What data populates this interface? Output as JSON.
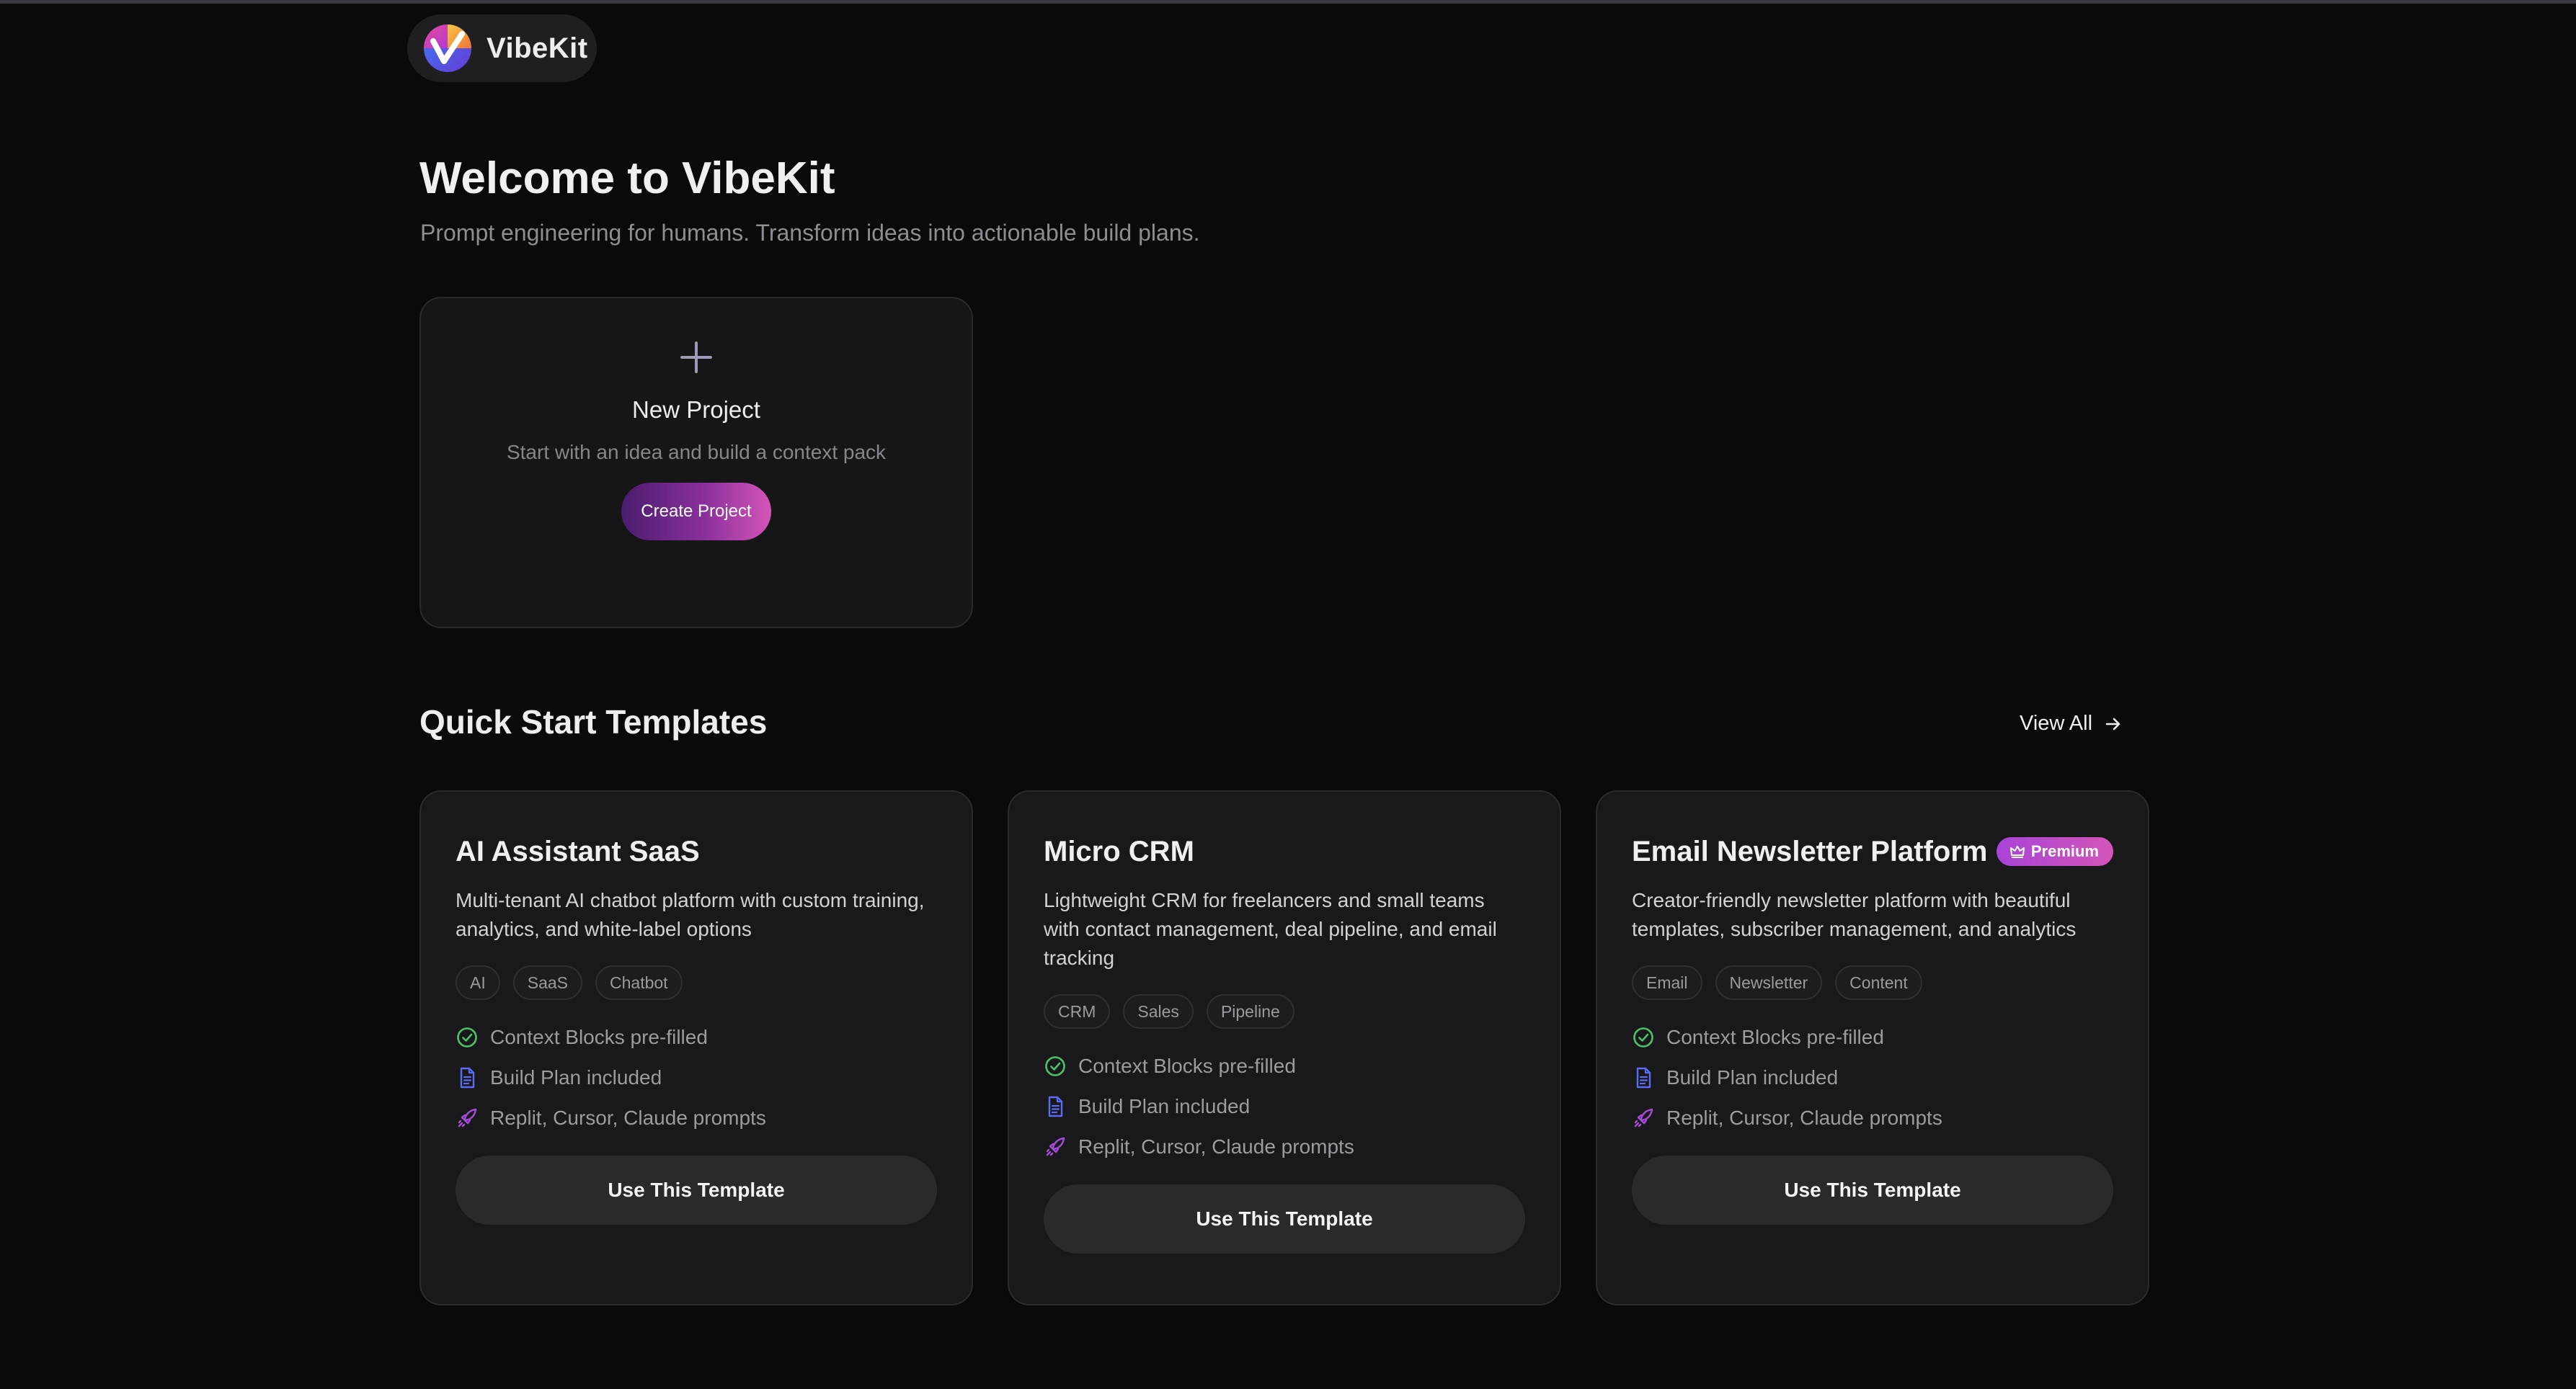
{
  "brand": {
    "name": "VibeKit",
    "logo_icon": "vibekit-logo-icon"
  },
  "welcome": {
    "title": "Welcome to VibeKit",
    "subtitle": "Prompt engineering for humans. Transform ideas into actionable build plans."
  },
  "new_project": {
    "icon": "plus-icon",
    "title": "New Project",
    "description": "Start with an idea and build a context pack",
    "button_label": "Create Project"
  },
  "templates_section": {
    "title": "Quick Start Templates",
    "view_all_label": "View All",
    "templates": [
      {
        "title": "AI Assistant SaaS",
        "premium": false,
        "description": "Multi-tenant AI chatbot platform with custom training, analytics, and white-label options",
        "tags": [
          "AI",
          "SaaS",
          "Chatbot"
        ],
        "features": [
          "Context Blocks pre-filled",
          "Build Plan included",
          "Replit, Cursor, Claude prompts"
        ],
        "button_label": "Use This Template"
      },
      {
        "title": "Micro CRM",
        "premium": false,
        "description": "Lightweight CRM for freelancers and small teams with contact management, deal pipeline, and email tracking",
        "tags": [
          "CRM",
          "Sales",
          "Pipeline"
        ],
        "features": [
          "Context Blocks pre-filled",
          "Build Plan included",
          "Replit, Cursor, Claude prompts"
        ],
        "button_label": "Use This Template"
      },
      {
        "title": "Email Newsletter Platform",
        "premium": true,
        "premium_label": "Premium",
        "description": "Creator-friendly newsletter platform with beautiful templates, subscriber management, and analytics",
        "tags": [
          "Email",
          "Newsletter",
          "Content"
        ],
        "features": [
          "Context Blocks pre-filled",
          "Build Plan included",
          "Replit, Cursor, Claude prompts"
        ],
        "button_label": "Use This Template"
      }
    ]
  },
  "colors": {
    "background": "#0a0a0b",
    "card": "#19191c",
    "accent_gradient_start": "#4a1c6e",
    "accent_gradient_end": "#d455b8",
    "check_green": "#4cc26a",
    "doc_blue": "#5a6cf0",
    "rocket_purple": "#a64bdc"
  }
}
